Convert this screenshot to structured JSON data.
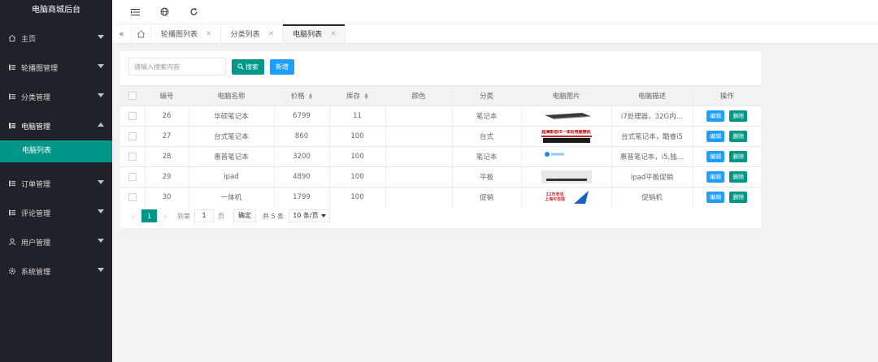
{
  "app": {
    "title": "电脑商城后台"
  },
  "sidebar": {
    "items": [
      {
        "label": "主页",
        "icon": "home-icon",
        "expanded": false
      },
      {
        "label": "轮播图管理",
        "icon": "list-icon",
        "expanded": false
      },
      {
        "label": "分类管理",
        "icon": "list-icon",
        "expanded": false
      },
      {
        "label": "电脑管理",
        "icon": "list-icon",
        "expanded": true,
        "children": [
          {
            "label": "电脑列表",
            "active": true
          }
        ]
      },
      {
        "label": "订单管理",
        "icon": "list-icon",
        "expanded": false
      },
      {
        "label": "评论管理",
        "icon": "list-icon",
        "expanded": false
      },
      {
        "label": "用户管理",
        "icon": "user-icon",
        "expanded": false
      },
      {
        "label": "系统管理",
        "icon": "gear-icon",
        "expanded": false
      }
    ]
  },
  "header": {
    "icons": [
      "menu-toggle-icon",
      "globe-icon",
      "refresh-icon"
    ]
  },
  "tabs": {
    "items": [
      {
        "label": "轮播图列表",
        "closable": true,
        "active": false
      },
      {
        "label": "分类列表",
        "closable": true,
        "active": false
      },
      {
        "label": "电脑列表",
        "closable": true,
        "active": true
      }
    ],
    "close_glyph": "×"
  },
  "toolbar": {
    "search_placeholder": "请输入搜索内容",
    "search_label": "搜索",
    "add_label": "新增"
  },
  "table": {
    "columns": [
      "编号",
      "电脑名称",
      "价格",
      "库存",
      "颜色",
      "分类",
      "电脑图片",
      "电脑描述",
      "操作"
    ],
    "rows": [
      {
        "id": "26",
        "name": "华硕笔记本",
        "price": "6799",
        "stock": "11",
        "color": "",
        "category": "笔记本",
        "description": "i7处理器，32G内…"
      },
      {
        "id": "27",
        "name": "台式笔记本",
        "price": "860",
        "stock": "100",
        "color": "",
        "category": "台式",
        "description": "台式笔记本，酷睿i5"
      },
      {
        "id": "28",
        "name": "惠普笔记本",
        "price": "3200",
        "stock": "100",
        "color": "",
        "category": "笔记本",
        "description": "惠普笔记本，i5,独…"
      },
      {
        "id": "29",
        "name": "ipad",
        "price": "4890",
        "stock": "100",
        "color": "",
        "category": "平板",
        "description": "ipad平板促销"
      },
      {
        "id": "30",
        "name": "一体机",
        "price": "1799",
        "stock": "100",
        "color": "",
        "category": "促销",
        "description": "促销机"
      }
    ],
    "edit_label": "编辑",
    "delete_label": "删除",
    "thumb_texts": [
      "",
      "超薄影音i5一体机电脑整机",
      "",
      "",
      "12年老店\n上海可自提"
    ]
  },
  "pagination": {
    "current": "1",
    "goto_label": "到第",
    "goto_value": "1",
    "page_label": "页",
    "confirm_label": "确定",
    "total_label": "共 5 条",
    "page_size": "10 条/页"
  },
  "colors": {
    "sidebar_bg": "#20222a",
    "accent": "#009688",
    "blue": "#1e9fff"
  }
}
